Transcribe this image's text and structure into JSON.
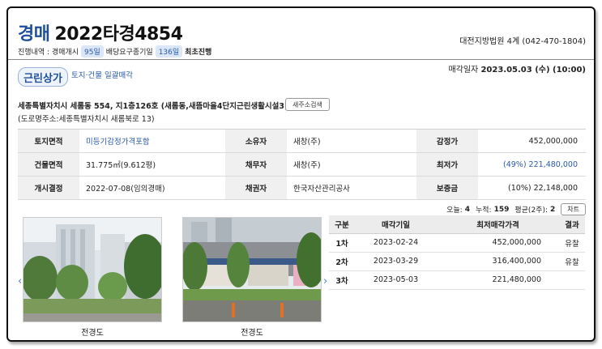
{
  "header": {
    "case_kind": "경매",
    "case_number": "2022타경4854",
    "court": "대전지방법원 4계 (042-470-1804)",
    "progress_label": "진행내역 : 경매개시",
    "progress_days1": "95일",
    "progress_mid": "배당요구종기일",
    "progress_days2": "136일",
    "progress_status": "최초진행",
    "sale_date_label": "매각일자",
    "sale_date_value": "2023.05.03 (수) (10:00)"
  },
  "property": {
    "use_type": "근린상가",
    "sale_type": "토지·건물 일괄매각",
    "address": "세종특별자치시 세롬동 554, 지1층126호 (새롬동,새뜸마을4단지근린생활시설3)",
    "address_button": "새주소검색",
    "road_address": "(도로명주소:세종특별자치시 새롬북로 13)"
  },
  "info_table": [
    [
      {
        "label": "토지면적",
        "value": "미등기감정가격포함",
        "blue": true
      },
      {
        "label": "소유자",
        "value": "새창(주)"
      },
      {
        "label": "감정가",
        "value": "452,000,000"
      }
    ],
    [
      {
        "label": "건물면적",
        "value": "31.775㎡(9.612평)"
      },
      {
        "label": "채무자",
        "value": "새창(주)"
      },
      {
        "label": "최저가",
        "value": "(49%) 221,480,000",
        "blue": true
      }
    ],
    [
      {
        "label": "개시결정",
        "value": "2022-07-08(임의경매)"
      },
      {
        "label": "채권자",
        "value": "한국자산관리공사"
      },
      {
        "label": "보증금",
        "value": "(10%) 22,148,000"
      }
    ]
  ],
  "stats": {
    "today_label": "오늘:",
    "today_value": "4",
    "total_label": "누적:",
    "total_value": "159",
    "avg_label": "평균(2주):",
    "avg_value": "2",
    "chart_button": "차트"
  },
  "rounds_table": {
    "headers": [
      "구분",
      "매각기일",
      "최저매각가격",
      "결과"
    ],
    "rows": [
      [
        "1차",
        "2023-02-24",
        "452,000,000",
        "유찰"
      ],
      [
        "2차",
        "2023-03-29",
        "316,400,000",
        "유찰"
      ],
      [
        "3차",
        "2023-05-03",
        "221,480,000",
        ""
      ]
    ]
  },
  "photos": {
    "caption1": "전경도",
    "caption2": "전경도"
  },
  "colors": {
    "accent_blue": "#1e4f9c",
    "link_blue": "#2a5aa8",
    "pill_bg": "#dbe7f7",
    "label_bg": "#f0f0f0"
  }
}
